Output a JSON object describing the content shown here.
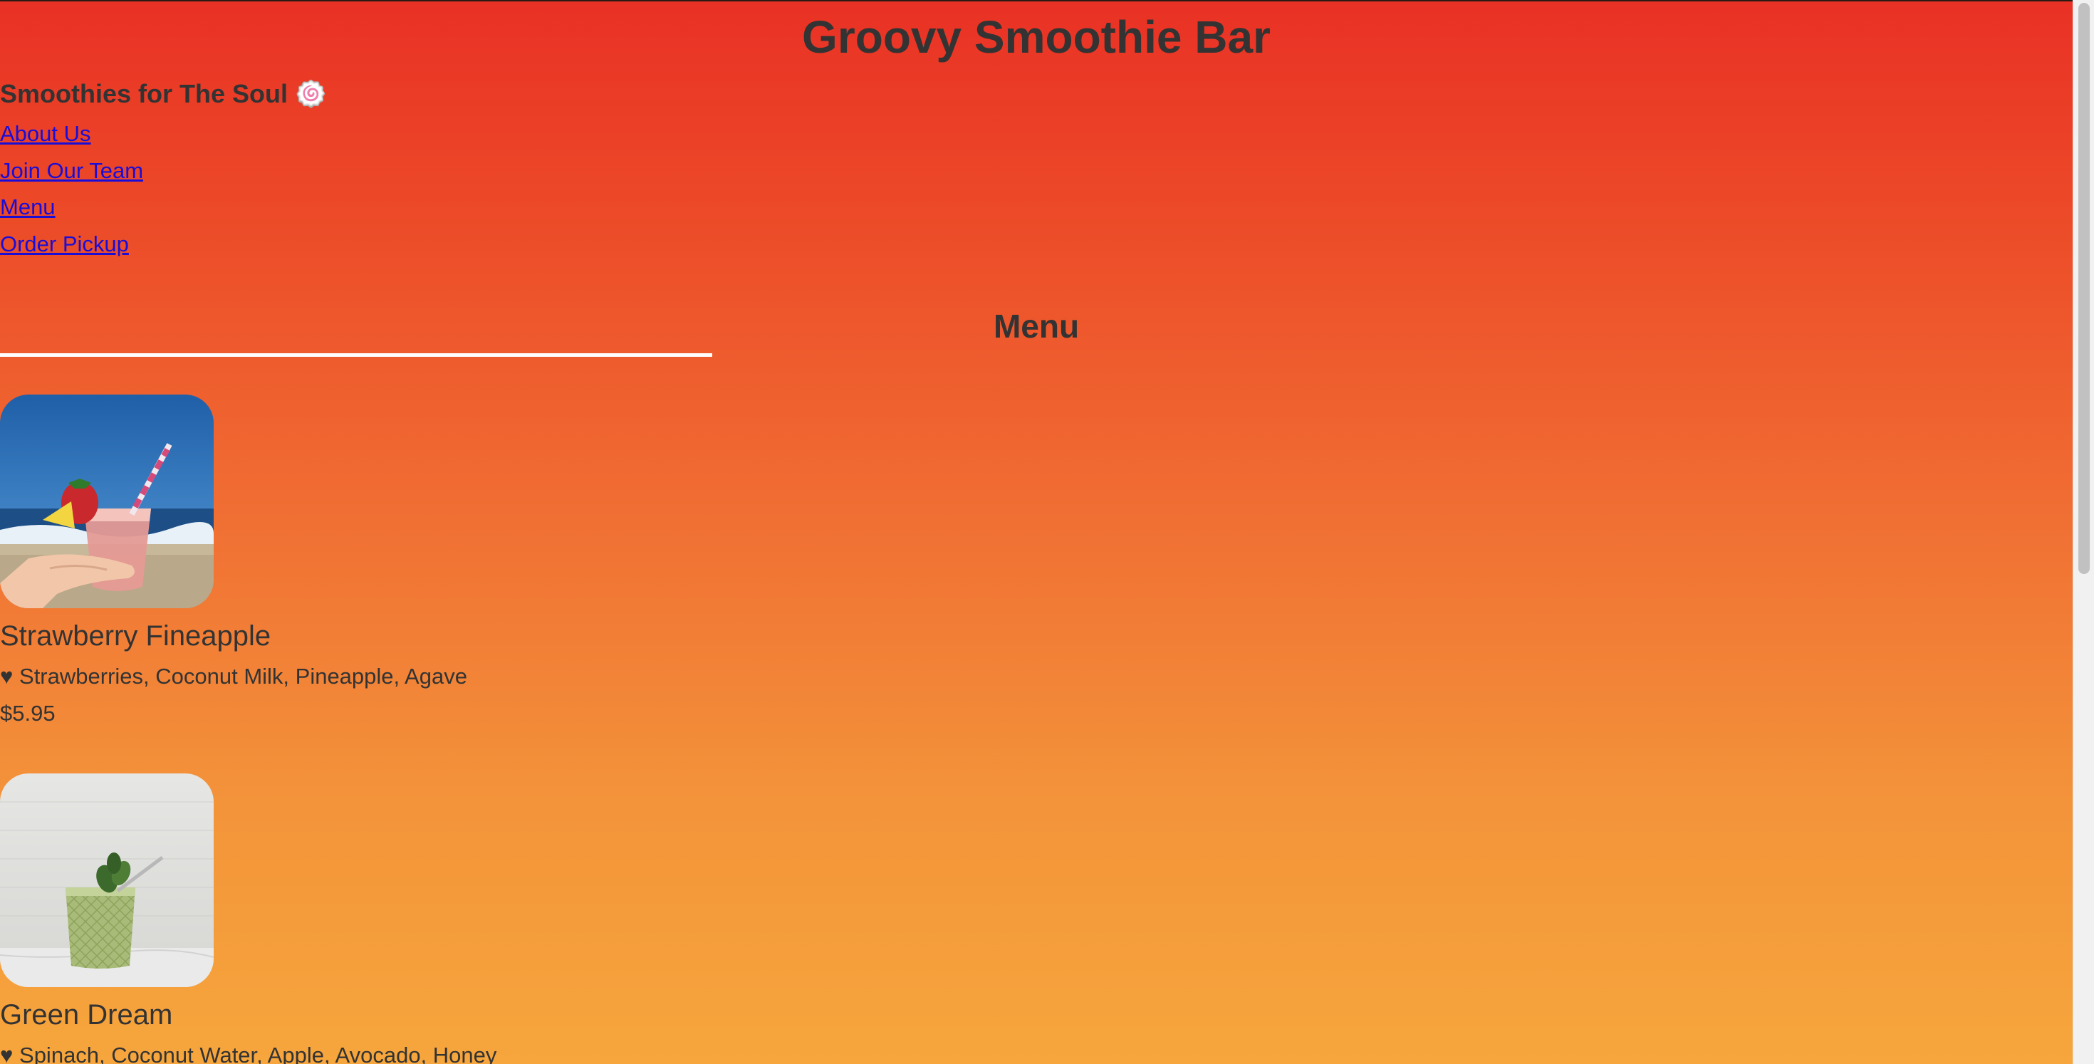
{
  "header": {
    "title": "Groovy Smoothie Bar",
    "tagline": "Smoothies for The Soul 🍥"
  },
  "nav": {
    "items": [
      {
        "label": "About Us"
      },
      {
        "label": "Join Our Team"
      },
      {
        "label": "Menu"
      },
      {
        "label": "Order Pickup"
      }
    ]
  },
  "menu": {
    "heading": "Menu",
    "items": [
      {
        "name": "Strawberry Fineapple",
        "ingredients": "♥ Strawberries, Coconut Milk, Pineapple, Agave",
        "price": "$5.95",
        "image_icon": "pink-smoothie-beach-photo"
      },
      {
        "name": "Green Dream",
        "ingredients": "♥ Spinach, Coconut Water, Apple, Avocado, Honey",
        "image_icon": "green-smoothie-photo"
      }
    ]
  },
  "colors": {
    "gradient_top": "#e93125",
    "gradient_bottom": "#f6a63c",
    "link": "#1a0dd8",
    "text": "#333333",
    "rule": "#ffffff"
  }
}
